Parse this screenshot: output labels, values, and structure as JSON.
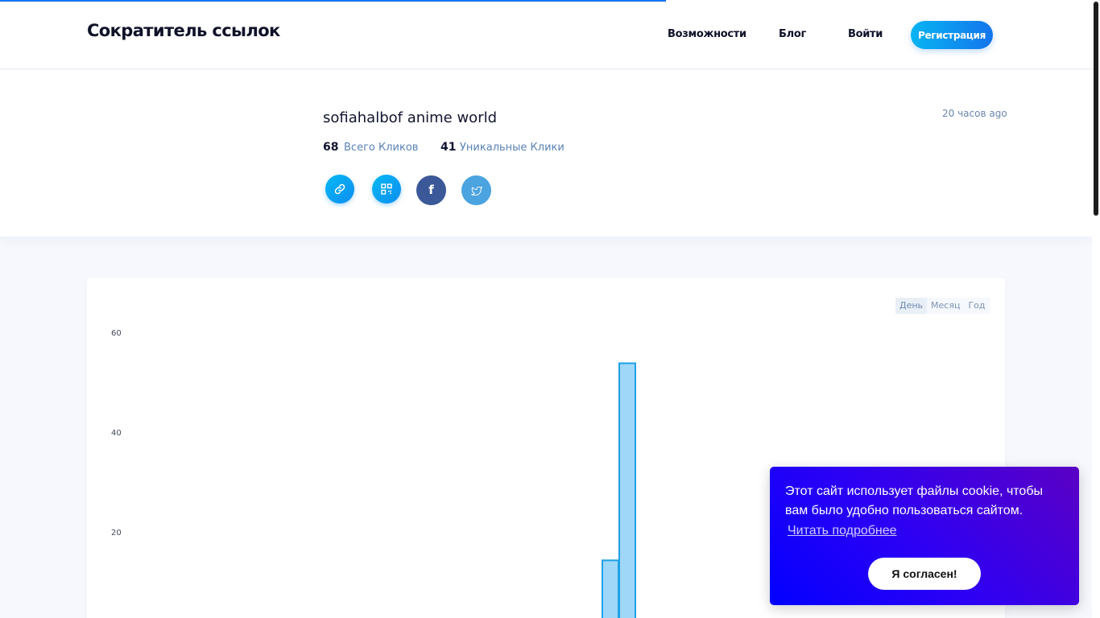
{
  "header": {
    "logo": "Сократитель ссылок",
    "nav": {
      "features": "Возможности",
      "blog": "Блог",
      "login": "Войти"
    },
    "register_label": "Регистрация"
  },
  "link": {
    "title": "sofiahalbof anime world",
    "time": "20 часов ago",
    "total_clicks": "68",
    "total_clicks_label": "Всего Кликов",
    "unique_clicks": "41",
    "unique_clicks_label": "Уникальные Клики",
    "share_icons": [
      "link-icon",
      "qr-code-icon",
      "facebook-icon",
      "twitter-icon"
    ]
  },
  "range_tabs": {
    "day": "День",
    "month": "Месяц",
    "year": "Год",
    "active": "day"
  },
  "chart_data": {
    "type": "bar",
    "ylim": [
      0,
      60
    ],
    "y_ticks": [
      20,
      40,
      60
    ],
    "bar_fill": "#9fd7f8",
    "bar_stroke": "#1ea0e6",
    "bars": [
      {
        "index": 0,
        "value": 14.3
      },
      {
        "index": 1,
        "value": 53.8
      }
    ],
    "title": "",
    "xlabel": "",
    "ylabel": ""
  },
  "cookie": {
    "message": "Этот сайт использует файлы cookie, чтобы вам было удобно пользоваться сайтом.",
    "link_label": "Читать подробнее",
    "accept_label": "Я согласен!"
  },
  "colors": {
    "accent": "#1475ec",
    "accent_light": "#08b4f3",
    "facebook": "#3b5998",
    "twitter": "#4ba3e0",
    "cookie_start": "#0200ff",
    "cookie_end": "#5b00c4"
  }
}
